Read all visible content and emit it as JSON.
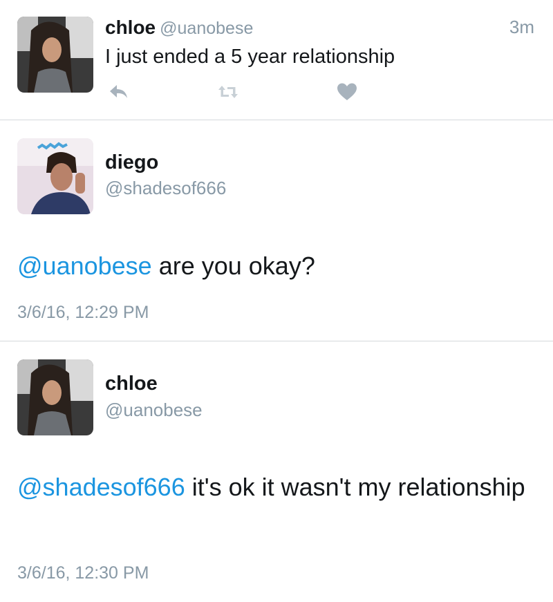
{
  "tweet": {
    "name": "chloe",
    "handle": "@uanobese",
    "time": "3m",
    "text": "I just ended a 5 year relationship",
    "actions": [
      "reply-icon",
      "retweet-icon",
      "like-icon"
    ],
    "action_color": "#a8b3bd",
    "like_color": "#8899a6"
  },
  "reply1": {
    "name": "diego",
    "handle": "@shadesof666",
    "mention": "@uanobese",
    "text": " are you okay?",
    "timestamp": "3/6/16, 12:29 PM"
  },
  "reply2": {
    "name": "chloe",
    "handle": "@uanobese",
    "mention": "@shadesof666",
    "text": " it's ok it wasn't my relationship",
    "timestamp": "3/6/16, 12:30 PM"
  },
  "colors": {
    "mention": "#1b95e0",
    "secondary_text": "#8899a6",
    "divider": "#d4d8dc"
  }
}
